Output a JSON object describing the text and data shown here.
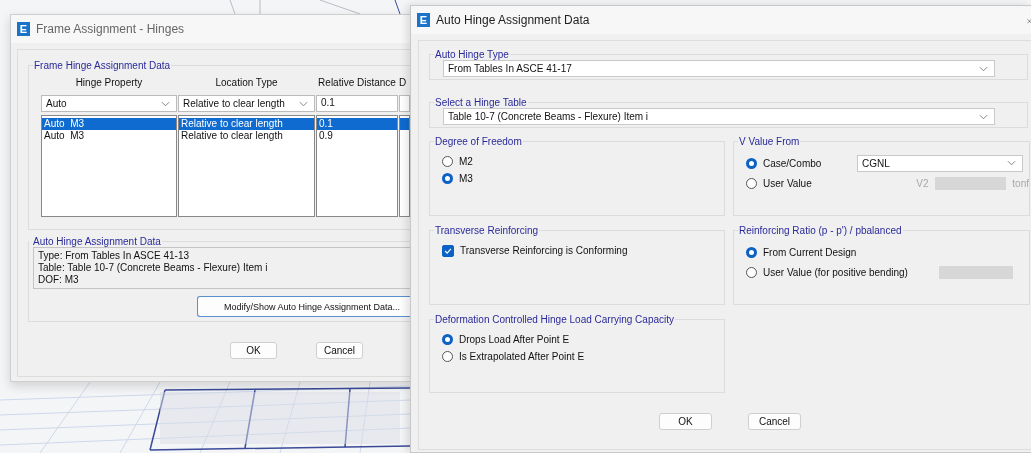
{
  "frame_window": {
    "logo": "E",
    "title": "Frame Assignment - Hinges",
    "hinge_group": {
      "title": "Frame Hinge Assignment Data",
      "columns": [
        "Hinge Property",
        "Location Type",
        "Relative Distance",
        "D"
      ],
      "edit_row": [
        {
          "kind": "combo",
          "value": "Auto"
        },
        {
          "kind": "combo",
          "value": "Relative to clear length"
        },
        {
          "kind": "text",
          "value": "0.1"
        }
      ],
      "rows": [
        {
          "cells": [
            "Auto  M3",
            "Relative to clear length",
            "0.1"
          ],
          "selected": true
        },
        {
          "cells": [
            "Auto  M3",
            "Relative to clear length",
            "0.9"
          ],
          "selected": false
        }
      ]
    },
    "auto_group": {
      "title": "Auto Hinge Assignment Data",
      "lines": [
        "Type:  From Tables In ASCE 41-13",
        "Table:  Table 10-7 (Concrete Beams - Flexure) Item i",
        "DOF:  M3"
      ]
    },
    "modify_button": "Modify/Show Auto Hinge Assignment Data...",
    "buttons": [
      "OK",
      "Cancel"
    ]
  },
  "auto_window": {
    "logo": "E",
    "title": "Auto Hinge Assignment Data",
    "auto_hinge_type": {
      "title": "Auto Hinge Type",
      "value": "From Tables In ASCE 41-17"
    },
    "hinge_table": {
      "title": "Select a Hinge Table",
      "value": "Table 10-7 (Concrete Beams - Flexure) Item i"
    },
    "dof": {
      "title": "Degree of Freedom",
      "options": [
        {
          "label": "M2",
          "selected": false
        },
        {
          "label": "M3",
          "selected": true
        }
      ]
    },
    "v_value": {
      "title": "V Value From",
      "options": [
        {
          "label": "Case/Combo",
          "selected": true
        },
        {
          "label": "User Value",
          "selected": false
        }
      ],
      "combo": "CGNL",
      "field_label": "V2",
      "unit": "tonf"
    },
    "transverse": {
      "title": "Transverse Reinforcing",
      "checkbox": {
        "label": "Transverse Reinforcing is Conforming",
        "checked": true
      }
    },
    "ratio": {
      "title": "Reinforcing Ratio  (p - p') / pbalanced",
      "options": [
        {
          "label": "From Current Design",
          "selected": true
        },
        {
          "label": "User Value (for positive bending)",
          "selected": false
        }
      ]
    },
    "deformation": {
      "title": "Deformation Controlled Hinge Load Carrying Capacity",
      "options": [
        {
          "label": "Drops Load After Point E",
          "selected": true
        },
        {
          "label": "Is Extrapolated After Point E",
          "selected": false
        }
      ]
    },
    "buttons": [
      "OK",
      "Cancel"
    ]
  }
}
